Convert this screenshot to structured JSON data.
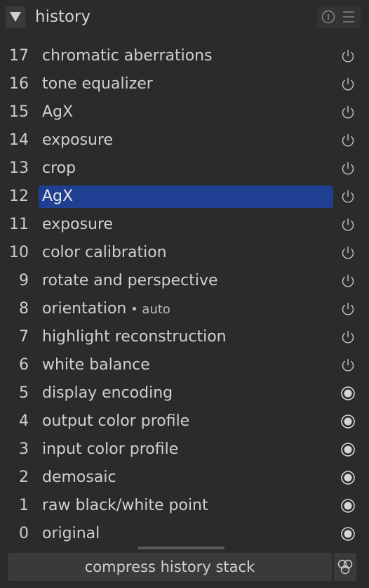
{
  "header": {
    "title": "history",
    "collapse_icon": "triangle-down-icon",
    "info_icon": "info-icon",
    "menu_icon": "hamburger-menu-icon"
  },
  "history_items": [
    {
      "num": "17",
      "label": "chromatic aberrations",
      "suffix": "",
      "status": "power-icon",
      "selected": false
    },
    {
      "num": "16",
      "label": "tone equalizer",
      "suffix": "",
      "status": "power-icon",
      "selected": false
    },
    {
      "num": "15",
      "label": "AgX",
      "suffix": "",
      "status": "power-icon",
      "selected": false
    },
    {
      "num": "14",
      "label": "exposure",
      "suffix": "",
      "status": "power-icon",
      "selected": false
    },
    {
      "num": "13",
      "label": "crop",
      "suffix": "",
      "status": "power-icon",
      "selected": false
    },
    {
      "num": "12",
      "label": "AgX",
      "suffix": "",
      "status": "power-icon",
      "selected": true
    },
    {
      "num": "11",
      "label": "exposure",
      "suffix": "",
      "status": "power-icon",
      "selected": false
    },
    {
      "num": "10",
      "label": "color calibration",
      "suffix": "",
      "status": "power-icon",
      "selected": false
    },
    {
      "num": "9",
      "label": "rotate and perspective",
      "suffix": "",
      "status": "power-icon",
      "selected": false
    },
    {
      "num": "8",
      "label": "orientation",
      "suffix": " • auto",
      "status": "power-icon",
      "selected": false
    },
    {
      "num": "7",
      "label": "highlight reconstruction",
      "suffix": "",
      "status": "power-icon",
      "selected": false
    },
    {
      "num": "6",
      "label": "white balance",
      "suffix": "",
      "status": "power-icon",
      "selected": false
    },
    {
      "num": "5",
      "label": "display encoding",
      "suffix": "",
      "status": "always-on-icon",
      "selected": false
    },
    {
      "num": "4",
      "label": "output color profile",
      "suffix": "",
      "status": "always-on-icon",
      "selected": false
    },
    {
      "num": "3",
      "label": "input color profile",
      "suffix": "",
      "status": "always-on-icon",
      "selected": false
    },
    {
      "num": "2",
      "label": "demosaic",
      "suffix": "",
      "status": "always-on-icon",
      "selected": false
    },
    {
      "num": "1",
      "label": "raw black/white point",
      "suffix": "",
      "status": "always-on-icon",
      "selected": false
    },
    {
      "num": "0",
      "label": "original",
      "suffix": "",
      "status": "always-on-icon",
      "selected": false
    }
  ],
  "footer": {
    "compress_label": "compress history stack",
    "compress_extra_icon": "create-style-icon"
  },
  "colors": {
    "background": "#2b2b2b",
    "selected": "#1f3f93",
    "button": "#3a3a3a",
    "text": "#cfcfcf"
  }
}
